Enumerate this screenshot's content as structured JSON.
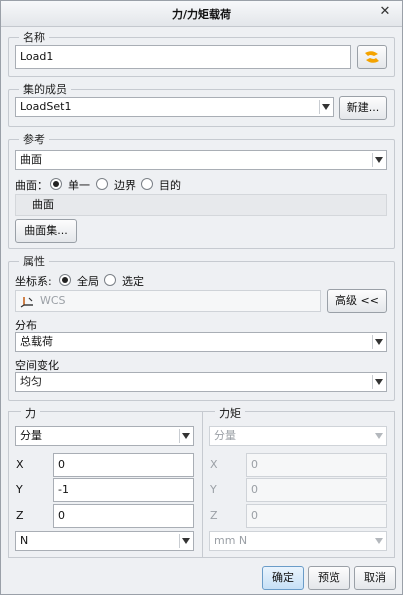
{
  "window": {
    "title": "力/力矩载荷",
    "close_icon": "close-icon"
  },
  "name_group": {
    "legend": "名称",
    "value": "Load1"
  },
  "set_group": {
    "legend": "集的成员",
    "selected": "LoadSet1",
    "new_button": "新建..."
  },
  "ref_group": {
    "legend": "参考",
    "type_selected": "曲面",
    "surface_label": "曲面：",
    "radios": [
      {
        "label": "单一",
        "checked": true
      },
      {
        "label": "边界",
        "checked": false
      },
      {
        "label": "目的",
        "checked": false
      }
    ],
    "collector_text": "曲面",
    "surface_set_button": "曲面集..."
  },
  "props_group": {
    "legend": "属性",
    "coord_label": "坐标系:",
    "coord_radios": [
      {
        "label": "全局",
        "checked": true
      },
      {
        "label": "选定",
        "checked": false
      }
    ],
    "coord_value": "WCS",
    "advanced_button": "高级 <<",
    "dist_label": "分布",
    "dist_selected": "总载荷",
    "spatial_label": "空间变化",
    "spatial_selected": "均匀"
  },
  "force": {
    "legend": "力",
    "mode": "分量",
    "rows": [
      {
        "axis": "X",
        "value": "0"
      },
      {
        "axis": "Y",
        "value": "-1"
      },
      {
        "axis": "Z",
        "value": "0"
      }
    ],
    "unit": "N"
  },
  "moment": {
    "legend": "力矩",
    "mode": "分量",
    "rows": [
      {
        "axis": "X",
        "value": "0"
      },
      {
        "axis": "Y",
        "value": "0"
      },
      {
        "axis": "Z",
        "value": "0"
      }
    ],
    "unit": "mm N"
  },
  "footer": {
    "ok": "确定",
    "preview": "预览",
    "cancel": "取消"
  },
  "colors": {
    "accent": "#f4a300",
    "primary_button": "#c6e0f6",
    "background": "#eef0f3"
  }
}
